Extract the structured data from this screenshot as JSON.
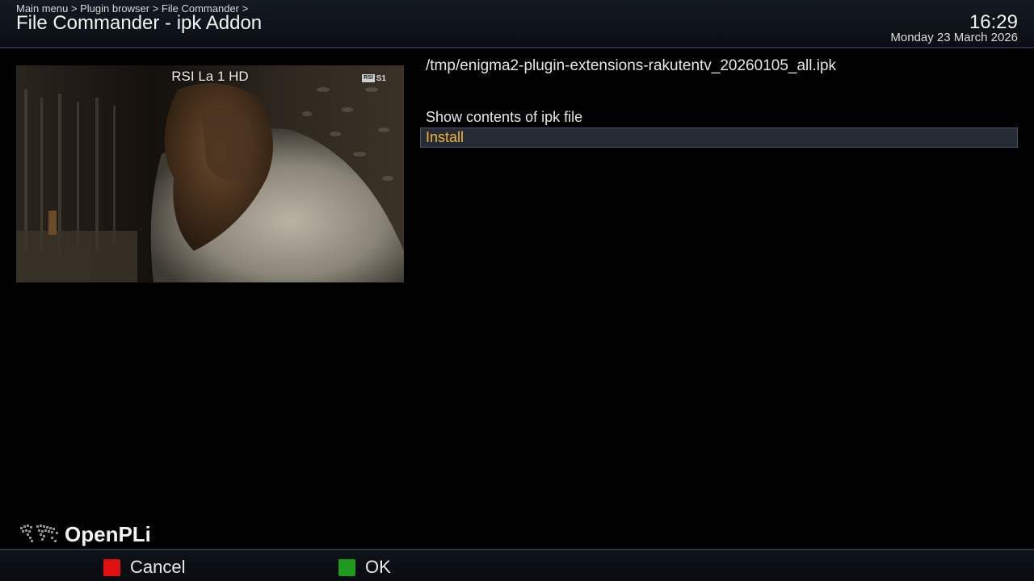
{
  "header": {
    "breadcrumb": "Main menu > Plugin browser > File Commander  >",
    "title": "File Commander - ipk Addon",
    "time": "16:29",
    "date": "Monday 23 March 2026"
  },
  "preview": {
    "channel_name": "RSI La 1 HD",
    "channel_logo_box": "RSI",
    "channel_logo_mark": "S1"
  },
  "file": {
    "path": "/tmp/enigma2-plugin-extensions-rakutentv_20260105_all.ipk"
  },
  "menu": {
    "items": [
      {
        "label": "Show contents of ipk file",
        "selected": false
      },
      {
        "label": "Install",
        "selected": true
      }
    ]
  },
  "brand": {
    "name": "OpenPLi"
  },
  "footer": {
    "red": {
      "label": "Cancel",
      "color": "#e11010"
    },
    "green": {
      "label": "OK",
      "color": "#1f9a1f"
    }
  },
  "colors": {
    "selected_text": "#f0b33a",
    "selected_bg": "#262b36"
  }
}
